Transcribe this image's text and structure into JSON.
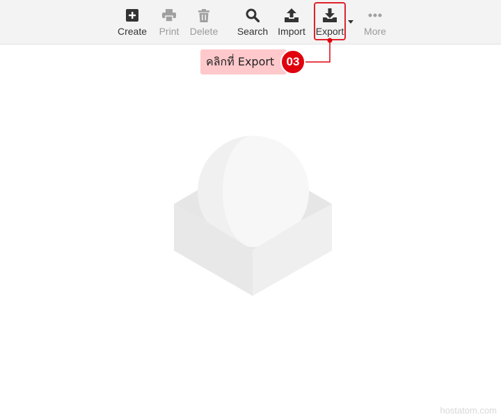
{
  "toolbar": {
    "items": [
      {
        "label": "Create",
        "icon": "plus-square-icon",
        "enabled": true
      },
      {
        "label": "Print",
        "icon": "printer-icon",
        "enabled": false
      },
      {
        "label": "Delete",
        "icon": "trash-icon",
        "enabled": false
      },
      {
        "label": "Search",
        "icon": "search-icon",
        "enabled": true
      },
      {
        "label": "Import",
        "icon": "upload-icon",
        "enabled": true
      },
      {
        "label": "Export",
        "icon": "download-icon",
        "enabled": true,
        "highlighted": true
      },
      {
        "label": "More",
        "icon": "more-dots-icon",
        "enabled": false
      }
    ]
  },
  "callout": {
    "text": "คลิกที่ Export",
    "step": "03",
    "accent": "#e0000e",
    "background": "#ffc9cc"
  },
  "watermark": "hostatom.com"
}
